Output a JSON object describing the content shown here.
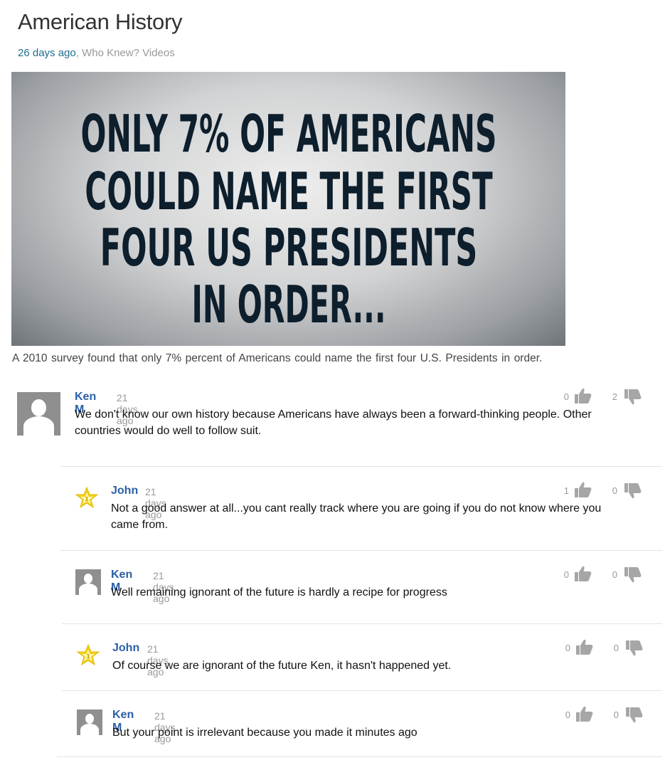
{
  "article": {
    "title": "American History",
    "date": "26 days ago",
    "separator": ",",
    "category": "Who Knew? Videos",
    "image_text": [
      "ONLY 7% OF AMERICANS",
      "COULD NAME THE FIRST",
      "FOUR US PRESIDENTS",
      "IN ORDER..."
    ],
    "caption": "A 2010 survey found that only 7% percent of Americans could name the first four U.S. Presidents in order."
  },
  "comments": [
    {
      "author": "Ken M",
      "time": "21 days ago",
      "avatar": "person-avatar-icon",
      "text_lines": [
        "We don't know our own history because Americans have always been a forward-thinking people. Other",
        "countries would do well to follow suit."
      ],
      "up": "0",
      "down": "2"
    },
    {
      "author": "John",
      "time": "21 days ago",
      "avatar": "star-avatar-icon",
      "text_lines": [
        "Not a good answer at all...you cant really track where you are going if you do not know where you",
        "came from."
      ],
      "up": "1",
      "down": "0"
    },
    {
      "author": "Ken M",
      "time": "21 days ago",
      "avatar": "person-avatar-icon",
      "text_lines": [
        "Well remaining ignorant of the future is hardly a recipe for progress"
      ],
      "up": "0",
      "down": "0"
    },
    {
      "author": "John",
      "time": "21 days ago",
      "avatar": "star-avatar-icon",
      "text_lines": [
        "Of course we are ignorant of the future Ken, it hasn't happened yet."
      ],
      "up": "0",
      "down": "0"
    },
    {
      "author": "Ken M",
      "time": "21 days ago",
      "avatar": "person-avatar-icon",
      "text_lines": [
        "But your point is irrelevant because you made it minutes ago"
      ],
      "up": "0",
      "down": "0"
    }
  ],
  "colors": {
    "link_blue": "#2b5fa8",
    "date_teal": "#1e6e8c",
    "muted_gray": "#999999",
    "star_yellow": "#f2d21a",
    "thumb_gray": "#a6a6a6"
  }
}
